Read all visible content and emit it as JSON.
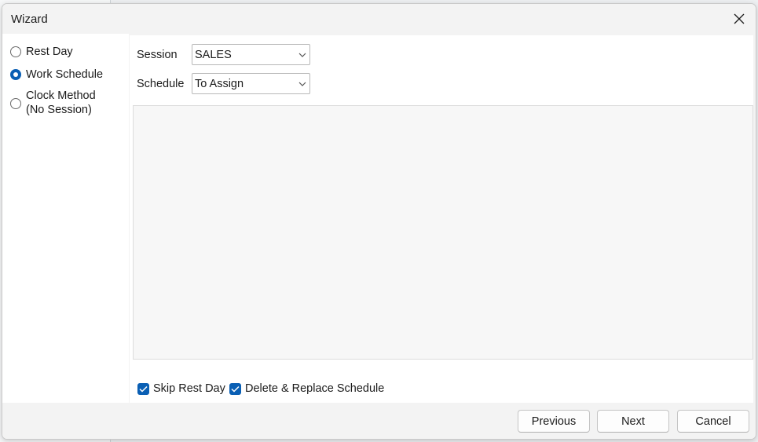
{
  "window": {
    "title": "Wizard"
  },
  "left_options": [
    {
      "label": "Rest Day",
      "checked": false
    },
    {
      "label": "Work Schedule",
      "checked": true
    },
    {
      "label_lines": [
        "Clock Method",
        "(No Session)"
      ],
      "checked": false
    }
  ],
  "form": {
    "session_label": "Session",
    "session_value": "SALES",
    "schedule_label": "Schedule",
    "schedule_value": "To Assign"
  },
  "checks": {
    "skip_rest_day": "Skip Rest Day",
    "delete_replace": "Delete & Replace Schedule"
  },
  "buttons": {
    "previous": "Previous",
    "next": "Next",
    "cancel": "Cancel"
  },
  "colors": {
    "accent": "#0a5fb4"
  }
}
